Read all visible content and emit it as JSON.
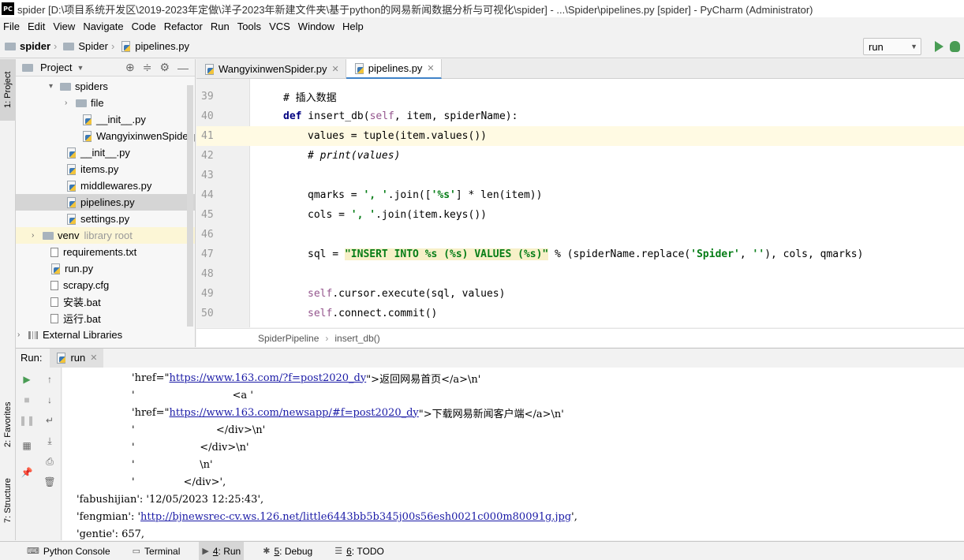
{
  "window": {
    "app_icon": "PC",
    "title": "spider [D:\\项目系统开发区\\2019-2023年定做\\洋子2023年新建文件夹\\基于python的网易新闻数据分析与可视化\\spider] - ...\\Spider\\pipelines.py [spider] - PyCharm (Administrator)"
  },
  "menu": [
    "File",
    "Edit",
    "View",
    "Navigate",
    "Code",
    "Refactor",
    "Run",
    "Tools",
    "VCS",
    "Window",
    "Help"
  ],
  "navbar": {
    "crumbs": [
      "spider",
      "Spider",
      "pipelines.py"
    ],
    "run_config": "run"
  },
  "left_strip": {
    "project_tab": "1: Project",
    "favorites_tab": "2: Favorites",
    "structure_tab": "7: Structure"
  },
  "project_panel": {
    "title": "Project",
    "tree": [
      {
        "label": "spiders",
        "type": "folder",
        "arrow": "down"
      },
      {
        "label": "file",
        "type": "folder",
        "arrow": "right"
      },
      {
        "label": "__init__.py",
        "type": "py"
      },
      {
        "label": "WangyixinwenSpider.py",
        "type": "py"
      },
      {
        "label": "__init__.py",
        "type": "py"
      },
      {
        "label": "items.py",
        "type": "py"
      },
      {
        "label": "middlewares.py",
        "type": "py"
      },
      {
        "label": "pipelines.py",
        "type": "py",
        "selected": true
      },
      {
        "label": "settings.py",
        "type": "py"
      },
      {
        "label": "venv",
        "type": "folder",
        "arrow": "right",
        "note": "library root"
      },
      {
        "label": "requirements.txt",
        "type": "file"
      },
      {
        "label": "run.py",
        "type": "py"
      },
      {
        "label": "scrapy.cfg",
        "type": "file"
      },
      {
        "label": "安装.bat",
        "type": "file"
      },
      {
        "label": "运行.bat",
        "type": "file"
      },
      {
        "label": "External Libraries",
        "type": "libs",
        "arrow": "right"
      }
    ]
  },
  "editor": {
    "tabs": [
      {
        "label": "WangyixinwenSpider.py",
        "active": false
      },
      {
        "label": "pipelines.py",
        "active": true
      }
    ],
    "line_numbers": [
      "39",
      "40",
      "41",
      "42",
      "43",
      "44",
      "45",
      "46",
      "47",
      "48",
      "49",
      "50"
    ],
    "code": {
      "l39": "# 插入数据",
      "l40_def": "def",
      "l40_name": " insert_db(",
      "l40_self": "self",
      "l40_rest": ", item, spiderName):",
      "l41": "values = tuple(item.values())",
      "l42": "# print(values)",
      "l44_a": "qmarks = ",
      "l44_s1": "', '",
      "l44_b": ".join([",
      "l44_s2": "'%s'",
      "l44_c": "] * len(item))",
      "l45_a": "cols = ",
      "l45_s": "', '",
      "l45_b": ".join(item.keys())",
      "l47_a": "sql = ",
      "l47_s": "\"INSERT INTO %s (%s) VALUES (%s)\"",
      "l47_b": " % (spiderName.replace(",
      "l47_s2": "'Spider'",
      "l47_c": ", ",
      "l47_s3": "''",
      "l47_d": "), cols, qmarks)",
      "l49_self": "self",
      "l49_rest": ".cursor.execute(sql, values)",
      "l50_self": "self",
      "l50_rest": ".connect.commit()"
    },
    "breadcrumb": [
      "SpiderPipeline",
      "insert_db()"
    ]
  },
  "run_panel": {
    "label": "Run:",
    "tab": "run",
    "console": [
      {
        "pre": "'href=\"",
        "link": "https://www.163.com/?f=post2020_dy",
        "post": "\">返回网易首页</a>\\n'"
      },
      {
        "pre": "'                              <a '",
        "link": "",
        "post": ""
      },
      {
        "pre": "'href=\"",
        "link": "https://www.163.com/newsapp/#f=post2020_dy",
        "post": "\">下载网易新闻客户端</a>\\n'"
      },
      {
        "pre": "'                         </div>\\n'",
        "link": "",
        "post": ""
      },
      {
        "pre": "'                    </div>\\n'",
        "link": "",
        "post": ""
      },
      {
        "pre": "'                    \\n'",
        "link": "",
        "post": ""
      },
      {
        "pre": "'               </div>',",
        "link": "",
        "post": ""
      },
      {
        "pre": "'fabushijian': '12/05/2023 12:25:43',",
        "link": "",
        "post": ""
      },
      {
        "pre": "'fengmian': '",
        "link": "http://bjnewsrec-cv.ws.126.net/little6443bb5b345j00s56esh0021c000m80091g.jpg",
        "post": "',"
      },
      {
        "pre": "'gentie': 657,",
        "link": "",
        "post": ""
      }
    ]
  },
  "bottom_tabs": [
    {
      "label": "Python Console",
      "num": ""
    },
    {
      "label": "Terminal",
      "num": ""
    },
    {
      "label": "Run",
      "num": "4"
    },
    {
      "label": "Debug",
      "num": "5"
    },
    {
      "label": "TODO",
      "num": "6"
    }
  ]
}
